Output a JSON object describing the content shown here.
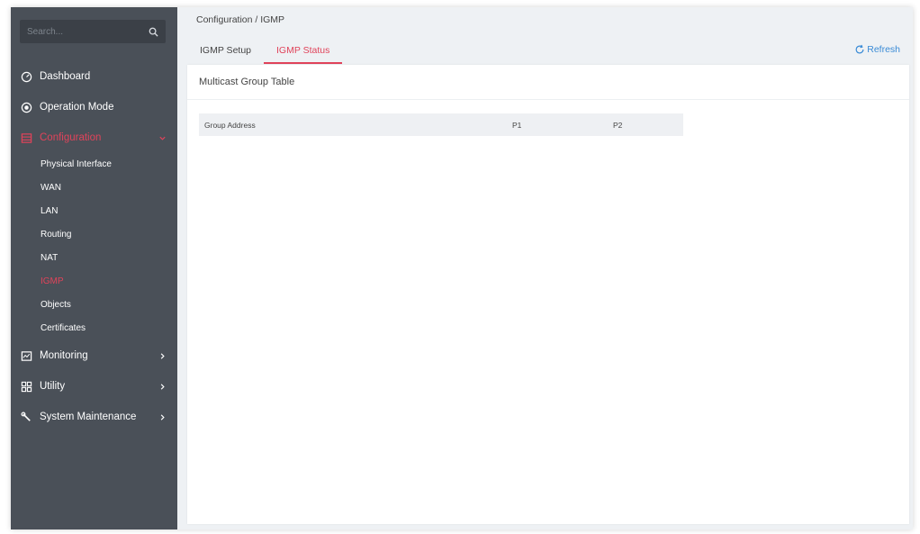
{
  "search": {
    "placeholder": "Search..."
  },
  "sidebar": {
    "items": [
      {
        "label": "Dashboard"
      },
      {
        "label": "Operation Mode"
      },
      {
        "label": "Configuration"
      },
      {
        "label": "Monitoring"
      },
      {
        "label": "Utility"
      },
      {
        "label": "System Maintenance"
      }
    ],
    "sub_items": [
      {
        "label": "Physical Interface"
      },
      {
        "label": "WAN"
      },
      {
        "label": "LAN"
      },
      {
        "label": "Routing"
      },
      {
        "label": "NAT"
      },
      {
        "label": "IGMP"
      },
      {
        "label": "Objects"
      },
      {
        "label": "Certificates"
      }
    ]
  },
  "header": {
    "breadcrumb": "Configuration / IGMP",
    "tabs": [
      {
        "label": "IGMP Setup"
      },
      {
        "label": "IGMP Status"
      }
    ],
    "refresh_label": "Refresh"
  },
  "panel": {
    "title": "Multicast Group Table",
    "columns": [
      "Group Address",
      "P1",
      "P2"
    ]
  },
  "colors": {
    "accent": "#e0435a",
    "sidebar": "#4a5058",
    "link": "#3a8bd6"
  }
}
